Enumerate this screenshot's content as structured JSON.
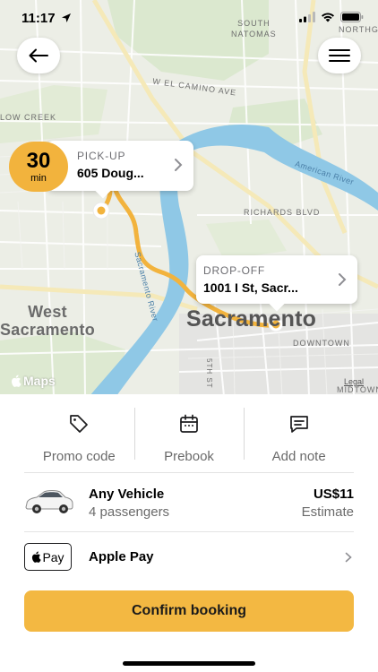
{
  "status_bar": {
    "time": "11:17"
  },
  "map": {
    "labels": {
      "south_natomas": "SOUTH\nNATOMAS",
      "northgate": "NORTHGATE",
      "w_el_camino": "W EL CAMINO AVE",
      "low_creek": "LOW CREEK",
      "american_river": "American River",
      "richards_blvd": "RICHARDS BLVD",
      "sacramento_river": "Sacramento River",
      "west_sacramento": "West\nSacramento",
      "sacramento": "Sacramento",
      "downtown": "DOWNTOWN",
      "fifth_st": "5TH ST",
      "midtown": "MIDTOWN"
    },
    "attribution": "Maps",
    "legal": "Legal",
    "eta": {
      "value": "30",
      "unit": "min"
    },
    "pickup": {
      "title": "PICK-UP",
      "address": "605 Doug..."
    },
    "dropoff": {
      "title": "DROP-OFF",
      "address": "1001 I St, Sacr..."
    },
    "route_color": "#f2b33d",
    "river_color": "#8fc8e6"
  },
  "actions": [
    {
      "label": "Promo code",
      "icon": "tag-icon"
    },
    {
      "label": "Prebook",
      "icon": "calendar-icon"
    },
    {
      "label": "Add note",
      "icon": "message-icon"
    }
  ],
  "vehicle": {
    "name": "Any Vehicle",
    "passengers": "4 passengers",
    "price": "US$11",
    "price_note": "Estimate"
  },
  "payment": {
    "badge": "Pay",
    "method": "Apple Pay"
  },
  "confirm_label": "Confirm booking",
  "accent_color": "#f3b842"
}
